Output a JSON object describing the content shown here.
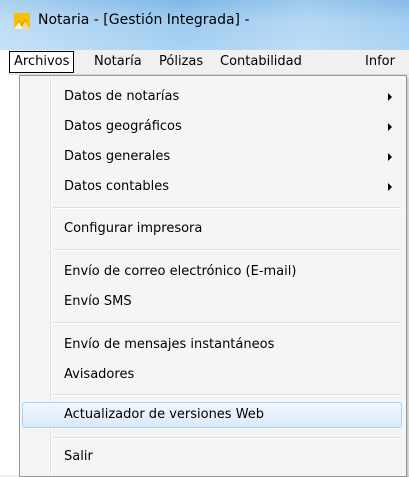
{
  "window": {
    "title": "Notaria - [Gestión Integrada] -",
    "icon": "app-icon"
  },
  "menubar": {
    "items": [
      {
        "label": "Archivos"
      },
      {
        "label": "Notaría"
      },
      {
        "label": "Pólizas"
      },
      {
        "label": "Contabilidad"
      },
      {
        "label": "Infor"
      }
    ]
  },
  "dropdown": {
    "items": [
      {
        "label": "Datos de notarías",
        "submenu": true
      },
      {
        "label": "Datos geográficos",
        "submenu": true
      },
      {
        "label": "Datos generales",
        "submenu": true
      },
      {
        "label": "Datos contables",
        "submenu": true
      },
      {
        "label": "Configurar impresora"
      },
      {
        "label": "Envío de correo electrónico (E-mail)"
      },
      {
        "label": "Envío SMS"
      },
      {
        "label": "Envío de mensajes instantáneos"
      },
      {
        "label": "Avisadores"
      },
      {
        "label": "Actualizador de versiones Web",
        "highlighted": true
      },
      {
        "label": "Salir"
      }
    ]
  },
  "colors": {
    "titlebar": "#9ccaf0",
    "highlight_border": "#aecff7",
    "menu_background": "#f5f5f5"
  }
}
